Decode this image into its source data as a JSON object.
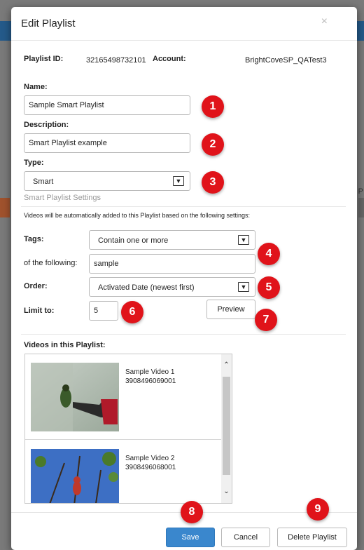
{
  "modal": {
    "title": "Edit Playlist",
    "close_glyph": "×"
  },
  "info": {
    "playlist_id_label": "Playlist ID:",
    "playlist_id_value": "32165498732101",
    "account_label": "Account:",
    "account_value": "BrightCoveSP_QATest3"
  },
  "fields": {
    "name_label": "Name:",
    "name_value": "Sample Smart Playlist",
    "description_label": "Description:",
    "description_value": "Smart Playlist example",
    "type_label": "Type:",
    "type_value": "Smart"
  },
  "smart_settings": {
    "heading": "Smart Playlist Settings",
    "note": "Videos will be automatically added to this Playlist based on the following settings:",
    "tags_label": "Tags:",
    "tags_value": "Contain one or more",
    "following_label": "of the following:",
    "following_value": "sample",
    "order_label": "Order:",
    "order_value": "Activated Date (newest first)",
    "limit_label": "Limit to:",
    "limit_value": "5",
    "preview_label": "Preview"
  },
  "videos": {
    "heading": "Videos in this Playlist:",
    "items": [
      {
        "title": "Sample Video 1",
        "id": "3908496069001"
      },
      {
        "title": "Sample Video 2",
        "id": "3908496068001"
      }
    ]
  },
  "footer": {
    "save_label": "Save",
    "cancel_label": "Cancel",
    "delete_label": "Delete Playlist"
  },
  "badges": [
    "1",
    "2",
    "3",
    "4",
    "5",
    "6",
    "7",
    "8",
    "9"
  ],
  "background": {
    "letter": "P"
  },
  "colors": {
    "primary": "#3a87cd",
    "badge": "#e0131a",
    "header_bar": "#245a8a"
  }
}
